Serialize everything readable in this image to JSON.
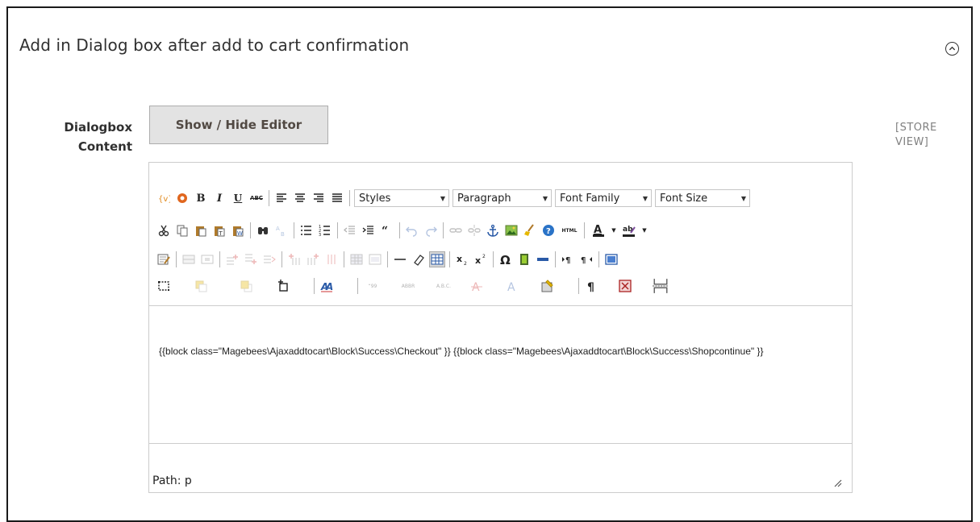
{
  "section": {
    "title": "Add in Dialog box after add to cart confirmation",
    "collapse_icon": "chevron-up-icon"
  },
  "field": {
    "label_line1": "Dialogbox",
    "label_line2": "Content",
    "toggle_label": "Show / Hide Editor",
    "scope_line1": "[STORE",
    "scope_line2": "VIEW]"
  },
  "toolbar": {
    "styles": "Styles",
    "paragraph": "Paragraph",
    "font_family": "Font Family",
    "font_size": "Font Size",
    "bold": "B",
    "italic": "I",
    "underline": "U",
    "strikethrough": "ABC",
    "html": "HTML",
    "font_color": "A",
    "highlight": "ab"
  },
  "editor": {
    "content": "{{block class=\"Magebees\\Ajaxaddtocart\\Block\\Success\\Checkout\" }} {{block class=\"Magebees\\Ajaxaddtocart\\Block\\Success\\Shopcontinue\" }}",
    "path": "Path: p"
  }
}
